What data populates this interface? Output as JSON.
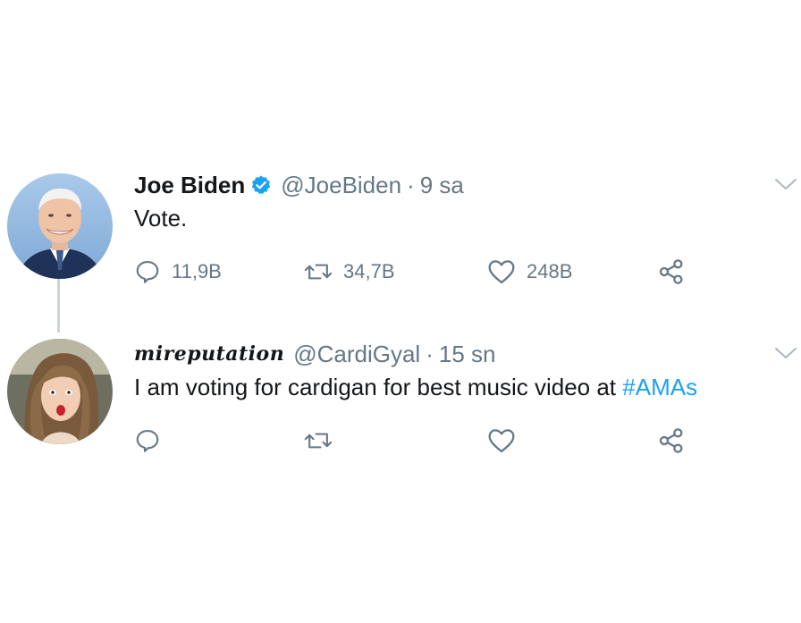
{
  "tweets": [
    {
      "name": "Joe Biden",
      "verified": true,
      "handle": "@JoeBiden",
      "separator": "·",
      "time": "9 sa",
      "text": "Vote.",
      "replies": "11,9B",
      "retweets": "34,7B",
      "likes": "248B"
    },
    {
      "name": "mireputation",
      "verified": false,
      "handle": "@CardiGyal",
      "separator": "·",
      "time": "15 sn",
      "text": "I am voting for cardigan for best music video at ",
      "hashtag": "#AMAs"
    }
  ],
  "colors": {
    "text": "#14171a",
    "secondary": "#657786",
    "accent": "#1da1f2",
    "thread_line": "#c9d2d9"
  },
  "icons": [
    "verified-badge-icon",
    "reply-icon",
    "retweet-icon",
    "like-icon",
    "share-icon",
    "chevron-down-icon"
  ]
}
